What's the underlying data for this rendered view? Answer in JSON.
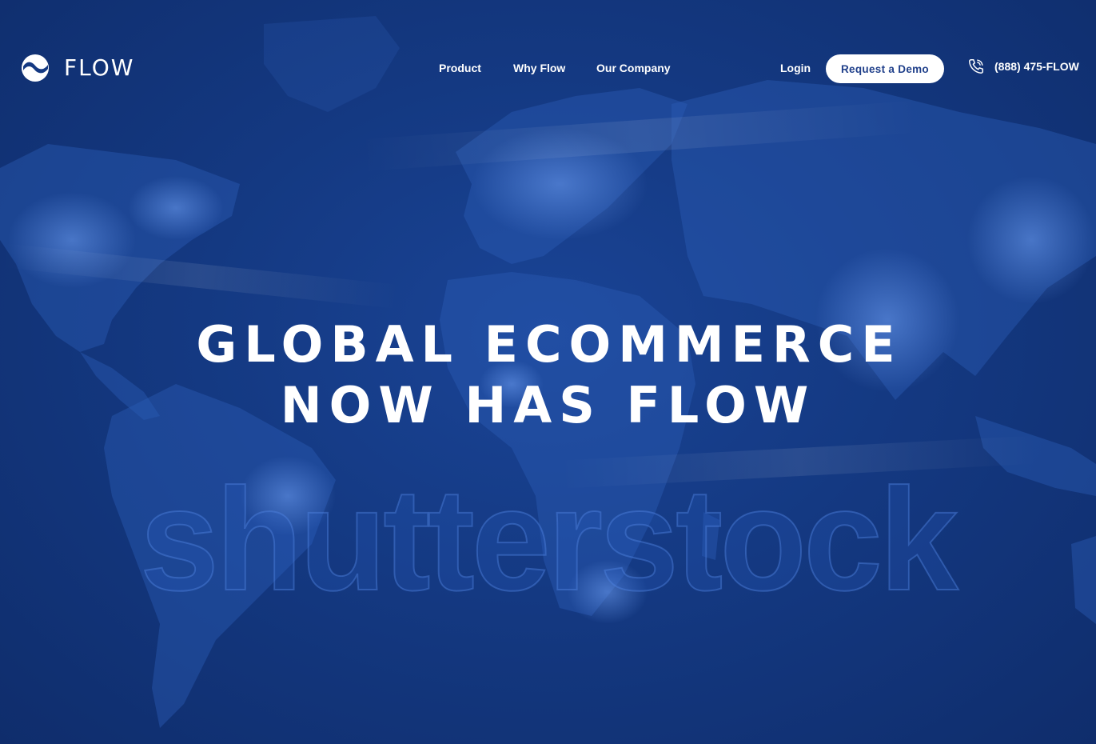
{
  "brand": {
    "name": "FLOW",
    "logo_icon": "flow-wave-circle-icon"
  },
  "nav": {
    "items": [
      {
        "label": "Product"
      },
      {
        "label": "Why Flow"
      },
      {
        "label": "Our Company"
      }
    ],
    "login_label": "Login",
    "demo_button_label": "Request a Demo",
    "phone": {
      "icon": "phone-icon",
      "number": "(888) 475-FLOW"
    }
  },
  "hero": {
    "title_line_1": "GLOBAL ECOMMERCE",
    "title_line_2": "NOW HAS FLOW"
  },
  "watermark": {
    "text": "shutterstock"
  },
  "colors": {
    "background": "#143982",
    "text": "#ffffff",
    "button_text": "#1f3f8a"
  }
}
